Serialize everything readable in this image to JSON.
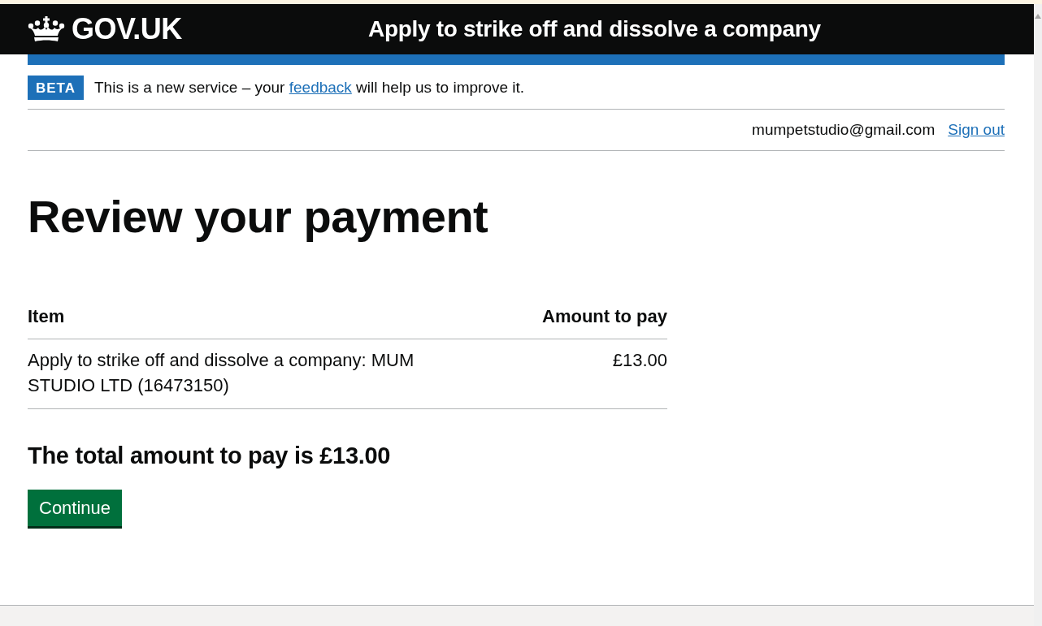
{
  "header": {
    "logo": "GOV.UK",
    "service_name": "Apply to strike off and dissolve a company"
  },
  "phase_banner": {
    "tag": "BETA",
    "message_before": "This is a new service – your",
    "link": "feedback",
    "message_after": "will help us to improve it."
  },
  "account": {
    "email": "mumpetstudio@gmail.com",
    "sign_out": "Sign out"
  },
  "title": "Review your payment",
  "table": {
    "columns": [
      "Item",
      "Amount to pay"
    ],
    "rows": [
      [
        "Apply to strike off and dissolve a company: MUM STUDIO LTD (16473150)",
        "£13.00"
      ]
    ]
  },
  "total": "The total amount to pay is £13.00",
  "buttons": [
    "Continue"
  ]
}
